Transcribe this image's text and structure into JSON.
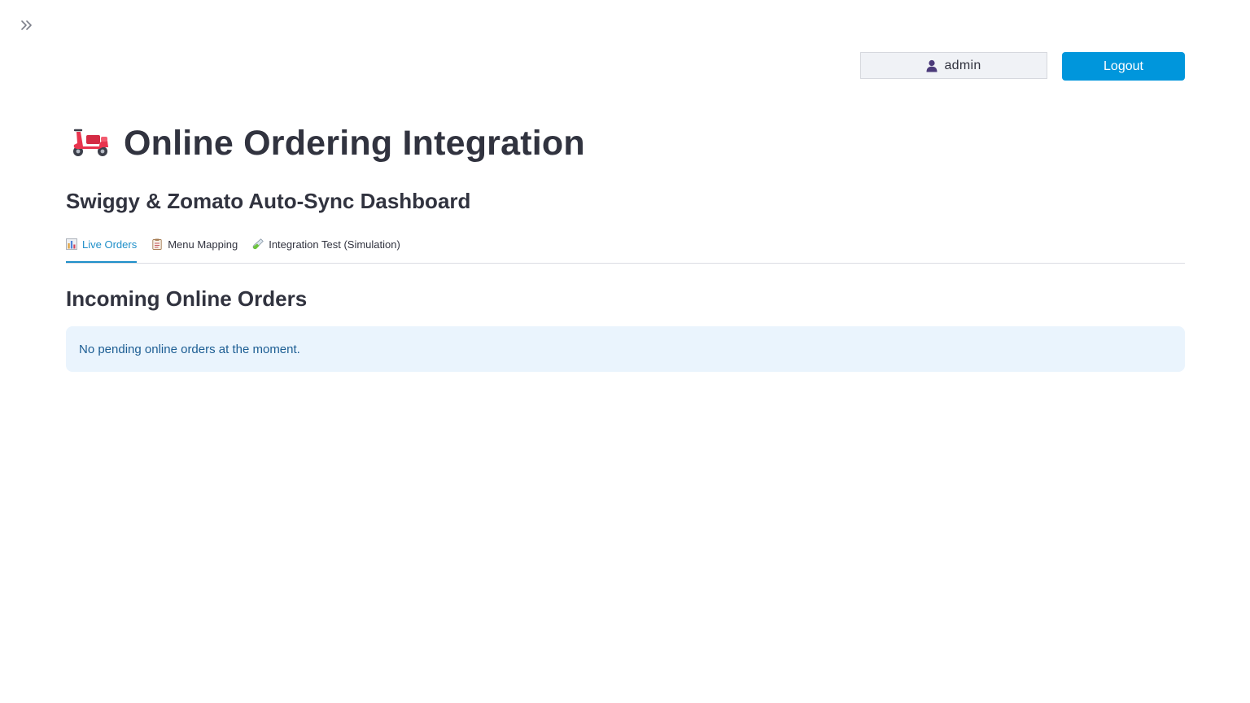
{
  "header": {
    "user_label": "admin",
    "logout_label": "Logout",
    "user_icon": "user-icon",
    "expand_icon": "chevrons-right-icon"
  },
  "page": {
    "title": "Online Ordering Integration",
    "title_icon": "scooter-icon",
    "subtitle": "Swiggy & Zomato Auto-Sync Dashboard"
  },
  "tabs": [
    {
      "label": "Live Orders",
      "icon": "bar-chart-icon",
      "active": true
    },
    {
      "label": "Menu Mapping",
      "icon": "clipboard-icon",
      "active": false
    },
    {
      "label": "Integration Test (Simulation)",
      "icon": "test-tube-icon",
      "active": false
    }
  ],
  "live_orders": {
    "section_title": "Incoming Online Orders",
    "info_message": "No pending online orders at the moment."
  },
  "colors": {
    "accent": "#1f8fc9",
    "button": "#0096dc",
    "info_bg": "#eaf4fd",
    "info_text": "#1c5d93"
  }
}
